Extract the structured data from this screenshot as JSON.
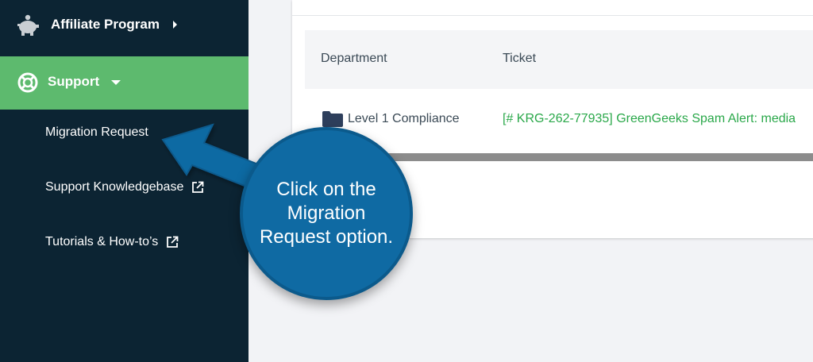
{
  "sidebar": {
    "affiliate": {
      "label": "Affiliate Program",
      "icon": "piggy-bank-icon"
    },
    "support": {
      "label": "Support",
      "icon": "lifebuoy-icon",
      "active_color": "#5dba6e"
    },
    "submenu": [
      {
        "label": "Migration Request",
        "external": false
      },
      {
        "label": "Support Knowledgebase",
        "external": true
      },
      {
        "label": "Tutorials & How-to’s",
        "external": true
      }
    ],
    "bg_color": "#0c2433"
  },
  "table": {
    "headers": {
      "department": "Department",
      "ticket": "Ticket"
    },
    "rows": [
      {
        "department": "Level 1 Compliance",
        "ticket": "[# KRG-262-77935] GreenGeeks Spam Alert: media"
      }
    ],
    "link_color": "#2aa84a"
  },
  "callout": {
    "text": "Click on the Migration Request option.",
    "color": "#0f6aa3"
  }
}
